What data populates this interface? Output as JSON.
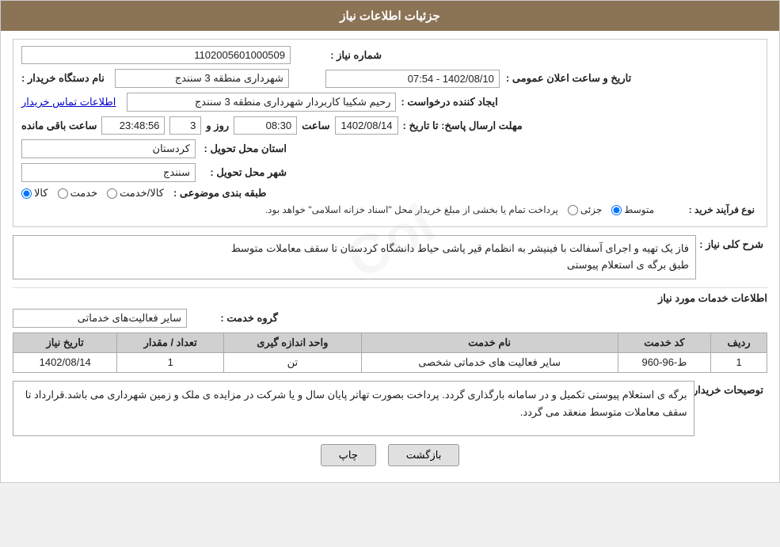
{
  "header": {
    "title": "جزئیات اطلاعات نیاز"
  },
  "fields": {
    "shomareNiaz_label": "شماره نیاز :",
    "shomareNiaz_value": "1102005601000509",
    "namDastgah_label": "نام دستگاه خریدار :",
    "namDastgah_value": "شهرداری منطقه 3 سنندج",
    "ijadKonande_label": "ایجاد کننده درخواست :",
    "ijadKonande_value": "رحیم شکیبا کاربردار شهرداری منطقه 3 سنندج",
    "ijadKonande_link": "اطلاعات تماس خریدار",
    "mohlat_label": "مهلت ارسال پاسخ: تا تاریخ :",
    "mohlat_date": "1402/08/14",
    "mohlat_saat_label": "ساعت",
    "mohlat_saat_value": "08:30",
    "mohlat_roz_label": "روز و",
    "mohlat_roz_value": "3",
    "mohlat_remaining": "23:48:56",
    "mohlat_remaining_label": "ساعت باقی مانده",
    "ostan_label": "استان محل تحویل :",
    "ostan_value": "کردستان",
    "shahr_label": "شهر محل تحویل :",
    "shahr_value": "سنندج",
    "tabaqe_label": "طبقه بندی موضوعی :",
    "tabaqe_options": [
      "کالا",
      "خدمت",
      "کالا/خدمت"
    ],
    "tabaqe_selected": "کالا",
    "farande_label": "نوع فرآیند خرید :",
    "farande_options": [
      "جزئی",
      "متوسط"
    ],
    "farande_selected": "متوسط",
    "farande_note": "پرداخت تمام یا بخشی از مبلغ خریدار محل \"اسناد خزانه اسلامی\" خواهد بود.",
    "taarikh_elaan_label": "تاریخ و ساعت اعلان عمومی :",
    "taarikh_elaan_value": "1402/08/10 - 07:54"
  },
  "sharh_section": {
    "title": "شرح کلی نیاز :",
    "text": "فاز یک تهیه و اجرای آسفالت با فینیشر به انظمام قیر پاشی حیاط دانشگاه کردستان تا سقف معاملات متوسط\nطبق برگه ی استعلام پیوستی"
  },
  "khadamat_section": {
    "title": "اطلاعات خدمات مورد نیاز",
    "group_label": "گروه خدمت :",
    "group_value": "سایر فعالیت‌های خدماتی",
    "table": {
      "columns": [
        "ردیف",
        "کد خدمت",
        "نام خدمت",
        "واحد اندازه گیری",
        "تعداد / مقدار",
        "تاریخ نیاز"
      ],
      "rows": [
        {
          "radif": "1",
          "kod": "ط-96-960",
          "name": "سایر فعالیت های خدماتی شخصی",
          "vahed": "تن",
          "tedad": "1",
          "tarikh": "1402/08/14"
        }
      ]
    }
  },
  "tousihaat_section": {
    "title": "توصیحات خریدار :",
    "text": "برگه ی استعلام پیوستی تکمیل و در سامانه بارگذاری گردد. پرداخت بصورت تهاتر پایان سال و یا شرکت در مزایده ی ملک و زمین شهرداری می باشد.قرارداد تا سقف معاملات متوسط منعقد می گردد."
  },
  "buttons": {
    "print": "چاپ",
    "back": "بازگشت"
  }
}
